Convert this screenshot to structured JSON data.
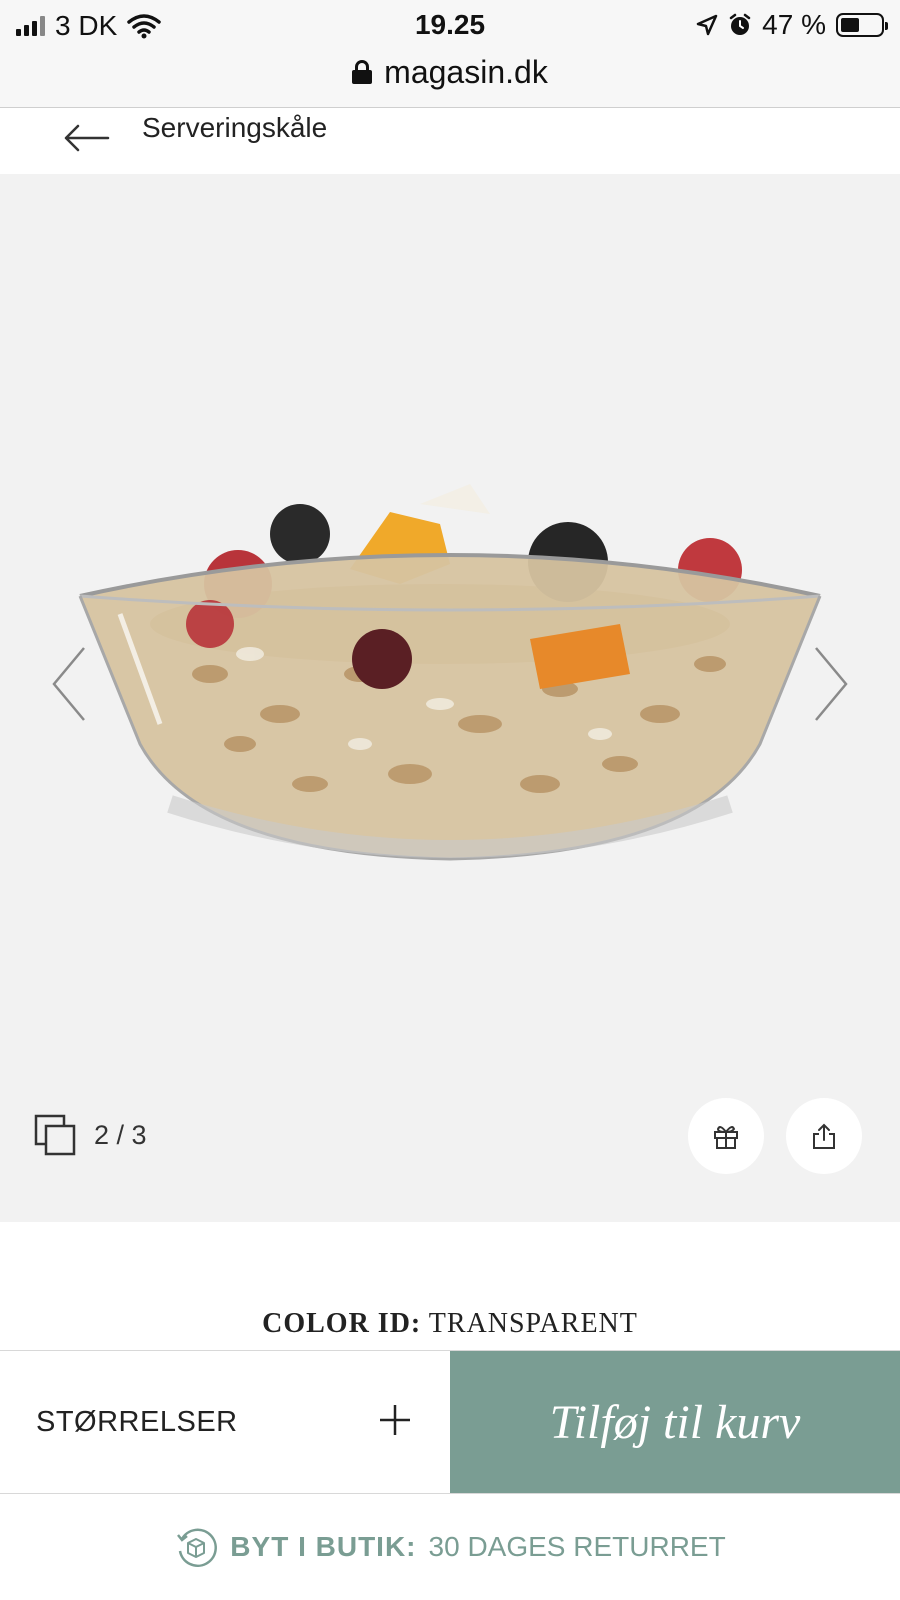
{
  "status_bar": {
    "carrier": "3 DK",
    "time": "19.25",
    "battery": "47 %",
    "icons": [
      "signal-icon",
      "wifi-icon",
      "location-icon",
      "alarm-icon",
      "battery-icon"
    ]
  },
  "browser": {
    "url": "magasin.dk",
    "icon": "lock-icon"
  },
  "header": {
    "title": "Serveringskåle",
    "back_icon": "back-arrow-icon"
  },
  "gallery": {
    "counter": "2 / 3",
    "current_index": 2,
    "total": 3,
    "icons": [
      "gallery-icon",
      "chevron-left-icon",
      "chevron-right-icon",
      "gift-icon",
      "share-icon"
    ]
  },
  "product": {
    "color_label": "COLOR ID:",
    "color_value": "TRANSPARENT"
  },
  "actions": {
    "sizes_label": "STØRRELSER",
    "add_to_cart_label": "Tilføj til kurv"
  },
  "return_banner": {
    "strong": "BYT I BUTIK:",
    "text": "30 DAGES RETURRET"
  },
  "colors": {
    "accent": "#7a9d93",
    "gallery_background": "#f2f2f2"
  }
}
